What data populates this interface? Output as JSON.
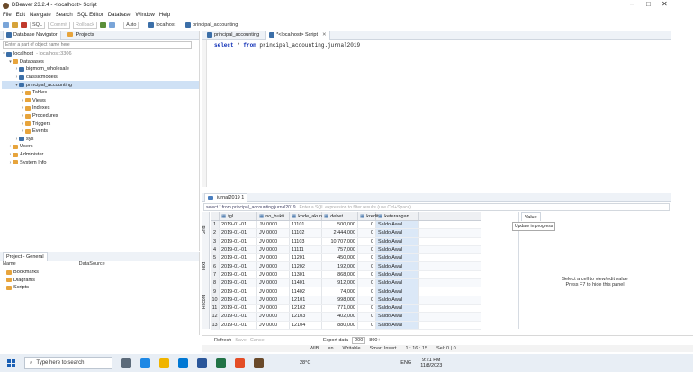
{
  "window": {
    "title": "DBeaver 23.2.4 - <localhost> Script",
    "min": "–",
    "max": "□",
    "close": "✕"
  },
  "menu": [
    "File",
    "Edit",
    "Navigate",
    "Search",
    "SQL Editor",
    "Database",
    "Window",
    "Help"
  ],
  "toolbar": {
    "sql_label": "SQL",
    "commit": "Commit",
    "rollback": "Rollback",
    "auto": "Auto",
    "connection": "localhost",
    "database": "principal_accounting"
  },
  "left_tabs": {
    "navigator": "Database Navigator",
    "projects": "Projects"
  },
  "filter_placeholder": "Enter a part of object name here",
  "tree": [
    {
      "label": "localhost",
      "suffix": "- localhost:3306",
      "icon": "db",
      "indent": 0,
      "arrow": "▾"
    },
    {
      "label": "Databases",
      "icon": "fold",
      "indent": 1,
      "arrow": "▾"
    },
    {
      "label": "bigmom_wholesale",
      "icon": "db",
      "indent": 2,
      "arrow": "›"
    },
    {
      "label": "classicmodels",
      "icon": "db",
      "indent": 2,
      "arrow": "›"
    },
    {
      "label": "principal_accounting",
      "icon": "db",
      "indent": 2,
      "arrow": "▾",
      "selected": true
    },
    {
      "label": "Tables",
      "icon": "fold",
      "indent": 3,
      "arrow": "›"
    },
    {
      "label": "Views",
      "icon": "fold",
      "indent": 3,
      "arrow": "›"
    },
    {
      "label": "Indexes",
      "icon": "fold",
      "indent": 3,
      "arrow": "›"
    },
    {
      "label": "Procedures",
      "icon": "fold",
      "indent": 3,
      "arrow": "›"
    },
    {
      "label": "Triggers",
      "icon": "fold",
      "indent": 3,
      "arrow": "›"
    },
    {
      "label": "Events",
      "icon": "fold",
      "indent": 3,
      "arrow": "›"
    },
    {
      "label": "sys",
      "icon": "db",
      "indent": 2,
      "arrow": "›"
    },
    {
      "label": "Users",
      "icon": "fold",
      "indent": 1,
      "arrow": "›"
    },
    {
      "label": "Administer",
      "icon": "fold",
      "indent": 1,
      "arrow": "›"
    },
    {
      "label": "System Info",
      "icon": "fold",
      "indent": 1,
      "arrow": "›"
    }
  ],
  "project_panel": {
    "tab": "Project - General",
    "col_name": "Name",
    "col_source": "DataSource",
    "items": [
      "Bookmarks",
      "Diagrams",
      "Scripts"
    ]
  },
  "editor_tabs": [
    "principal_accounting",
    "*<localhost> Script"
  ],
  "editor_code": {
    "kw1": "select",
    "rest1": " * ",
    "kw2": "from",
    "rest2": " principal_accounting.jurnal2019"
  },
  "results_tab": "jurnal2019 1",
  "result_filter": {
    "query": "select * from principal_accounting.jurnal2019",
    "hint": "Enter a SQL expression to filter results (use Ctrl+Space)"
  },
  "columns": [
    "tgl",
    "no_bukti",
    "kode_akun",
    "debet",
    "kredit",
    "keterangan"
  ],
  "rows": [
    [
      "1",
      "2019-01-01",
      "JV 0000",
      "11101",
      "500,000",
      "0",
      "Saldo Awal"
    ],
    [
      "2",
      "2019-01-01",
      "JV 0000",
      "11102",
      "2,444,000",
      "0",
      "Saldo Awal"
    ],
    [
      "3",
      "2019-01-01",
      "JV 0000",
      "11103",
      "10,707,000",
      "0",
      "Saldo Awal"
    ],
    [
      "4",
      "2019-01-01",
      "JV 0000",
      "11111",
      "757,000",
      "0",
      "Saldo Awal"
    ],
    [
      "5",
      "2019-01-01",
      "JV 0000",
      "11201",
      "450,000",
      "0",
      "Saldo Awal"
    ],
    [
      "6",
      "2019-01-01",
      "JV 0000",
      "11202",
      "192,000",
      "0",
      "Saldo Awal"
    ],
    [
      "7",
      "2019-01-01",
      "JV 0000",
      "11301",
      "868,000",
      "0",
      "Saldo Awal"
    ],
    [
      "8",
      "2019-01-01",
      "JV 0000",
      "11401",
      "912,000",
      "0",
      "Saldo Awal"
    ],
    [
      "9",
      "2019-01-01",
      "JV 0000",
      "11402",
      "74,000",
      "0",
      "Saldo Awal"
    ],
    [
      "10",
      "2019-01-01",
      "JV 0000",
      "12101",
      "998,000",
      "0",
      "Saldo Awal"
    ],
    [
      "11",
      "2019-01-01",
      "JV 0000",
      "12102",
      "771,000",
      "0",
      "Saldo Awal"
    ],
    [
      "12",
      "2019-01-01",
      "JV 0000",
      "12103",
      "402,000",
      "0",
      "Saldo Awal"
    ],
    [
      "13",
      "2019-01-01",
      "JV 0000",
      "12104",
      "880,000",
      "0",
      "Saldo Awal"
    ]
  ],
  "side_tabs": [
    "Grid",
    "Text",
    "Record"
  ],
  "value_panel": {
    "tab": "Value",
    "tooltip": "Update in progress",
    "msg1": "Select a cell to view/edit value",
    "msg2": "Press F7 to hide this panel"
  },
  "statusbar": {
    "refresh": "Refresh",
    "save": "Save",
    "cancel": "Cancel",
    "export": "Export data",
    "limit": "200",
    "count": "800+"
  },
  "bottom": {
    "wib": "WIB",
    "lang": "en",
    "writable": "Writable",
    "insert": "Smart Insert",
    "pos": "1 : 16 : 15",
    "sel": "Sel: 0 | 0"
  },
  "taskbar": {
    "search": "Type here to search",
    "temp": "28°C",
    "time": "9:21 PM",
    "date": "11/8/2023",
    "lang": "ENG"
  },
  "colors": {
    "accent": "#3c6fa8",
    "folder": "#e7a43c",
    "selection": "#cfe1f5",
    "keyword": "#0a2bb5"
  }
}
